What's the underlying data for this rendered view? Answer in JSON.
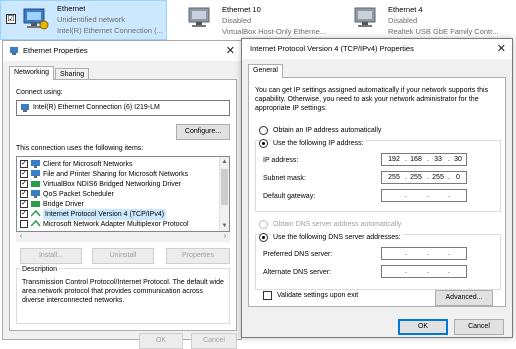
{
  "connections": [
    {
      "name": "Ethernet",
      "status": "Unidentified network",
      "device": "Intel(R) Ethernet Connection (...",
      "checkbox": "☑"
    },
    {
      "name": "Ethernet 10",
      "status": "Disabled",
      "device": "VirtualBox Host-Only Etherne..."
    },
    {
      "name": "Ethernet 4",
      "status": "Disabled",
      "device": "Realtek USB GbE Family Contr..."
    }
  ],
  "eth_props": {
    "title": "Ethernet Properties",
    "close": "✕",
    "tabs": [
      "Networking",
      "Sharing"
    ],
    "connect_using_label": "Connect using:",
    "adapter": "Intel(R) Ethernet Connection (6) I219-LM",
    "configure_button": "Configure...",
    "items_label": "This connection uses the following items:",
    "items": [
      {
        "label": "Client for Microsoft Networks",
        "check": "✓"
      },
      {
        "label": "File and Printer Sharing for Microsoft Networks",
        "check": "✓"
      },
      {
        "label": "VirtualBox NDIS6 Bridged Networking Driver",
        "check": "✓"
      },
      {
        "label": "QoS Packet Scheduler",
        "check": "✓"
      },
      {
        "label": "Bridge Driver",
        "check": "✓"
      },
      {
        "label": "Internet Protocol Version 4 (TCP/IPv4)",
        "check": "✓"
      },
      {
        "label": "Microsoft Network Adapter Multiplexor Protocol",
        "check": ""
      }
    ],
    "install_button": "Install...",
    "uninstall_button": "Uninstall",
    "properties_button": "Properties",
    "description_label": "Description",
    "description_text": "Transmission Control Protocol/Internet Protocol. The default wide area network protocol that provides communication across diverse interconnected networks.",
    "ok_button": "OK",
    "cancel_button": "Cancel"
  },
  "ipv4": {
    "title": "Internet Protocol Version 4 (TCP/IPv4) Properties",
    "close": "✕",
    "tab": "General",
    "intro": "You can get IP settings assigned automatically if your network supports this capability. Otherwise, you need to ask your network administrator for the appropriate IP settings.",
    "obtain_auto_label": "Obtain an IP address automatically",
    "use_following_label": "Use the following IP address:",
    "ip_label": "IP address:",
    "ip_value": [
      "192",
      "168",
      "33",
      "30"
    ],
    "subnet_label": "Subnet mask:",
    "subnet_value": [
      "255",
      "255",
      "255",
      "0"
    ],
    "gateway_label": "Default gateway:",
    "dns_auto_label": "Obtain DNS server address automatically",
    "dns_following_label": "Use the following DNS server addresses:",
    "preferred_dns_label": "Preferred DNS server:",
    "alternate_dns_label": "Alternate DNS server:",
    "validate_label": "Validate settings upon exit",
    "advanced_button": "Advanced...",
    "ok_button": "OK",
    "cancel_button": "Cancel"
  },
  "colors": {
    "accent": "#0078d7",
    "selection": "#cce8ff",
    "dialog_bg": "#f0f0f0"
  }
}
